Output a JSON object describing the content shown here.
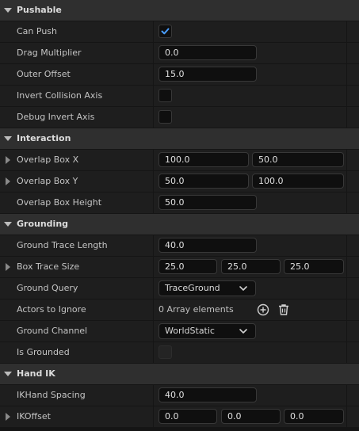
{
  "categories": {
    "pushable": "Pushable",
    "interaction": "Interaction",
    "grounding": "Grounding",
    "hand_ik": "Hand IK"
  },
  "props": {
    "can_push": {
      "label": "Can Push",
      "checked": true
    },
    "drag_multiplier": {
      "label": "Drag Multiplier",
      "value": "0.0"
    },
    "outer_offset": {
      "label": "Outer Offset",
      "value": "15.0"
    },
    "invert_collision_axis": {
      "label": "Invert Collision Axis",
      "checked": false
    },
    "debug_invert_axis": {
      "label": "Debug Invert Axis",
      "checked": false
    },
    "overlap_box_x": {
      "label": "Overlap Box X",
      "values": [
        "100.0",
        "50.0"
      ]
    },
    "overlap_box_y": {
      "label": "Overlap Box Y",
      "values": [
        "50.0",
        "100.0"
      ]
    },
    "overlap_box_height": {
      "label": "Overlap Box Height",
      "value": "50.0"
    },
    "ground_trace_length": {
      "label": "Ground Trace Length",
      "value": "40.0"
    },
    "box_trace_size": {
      "label": "Box Trace Size",
      "values": [
        "25.0",
        "25.0",
        "25.0"
      ]
    },
    "ground_query": {
      "label": "Ground Query",
      "selected": "TraceGround"
    },
    "actors_to_ignore": {
      "label": "Actors to Ignore",
      "value": "0 Array elements"
    },
    "ground_channel": {
      "label": "Ground Channel",
      "selected": "WorldStatic"
    },
    "is_grounded": {
      "label": "Is Grounded",
      "checked": false
    },
    "ikhand_spacing": {
      "label": "IKHand Spacing",
      "value": "40.0"
    },
    "ikoffset": {
      "label": "IKOffset",
      "values": [
        "0.0",
        "0.0",
        "0.0"
      ]
    }
  },
  "icons": {
    "expand": "chevron-down-icon",
    "collapsed": "chevron-right-icon",
    "add": "plus-circle-icon",
    "delete": "trash-icon",
    "check": "checkmark-icon"
  },
  "colors": {
    "check_accent": "#4a9eff",
    "category_bg": "#2f2f2f",
    "row_bg": "#1e1e1e",
    "field_bg": "#0f0f0f"
  }
}
